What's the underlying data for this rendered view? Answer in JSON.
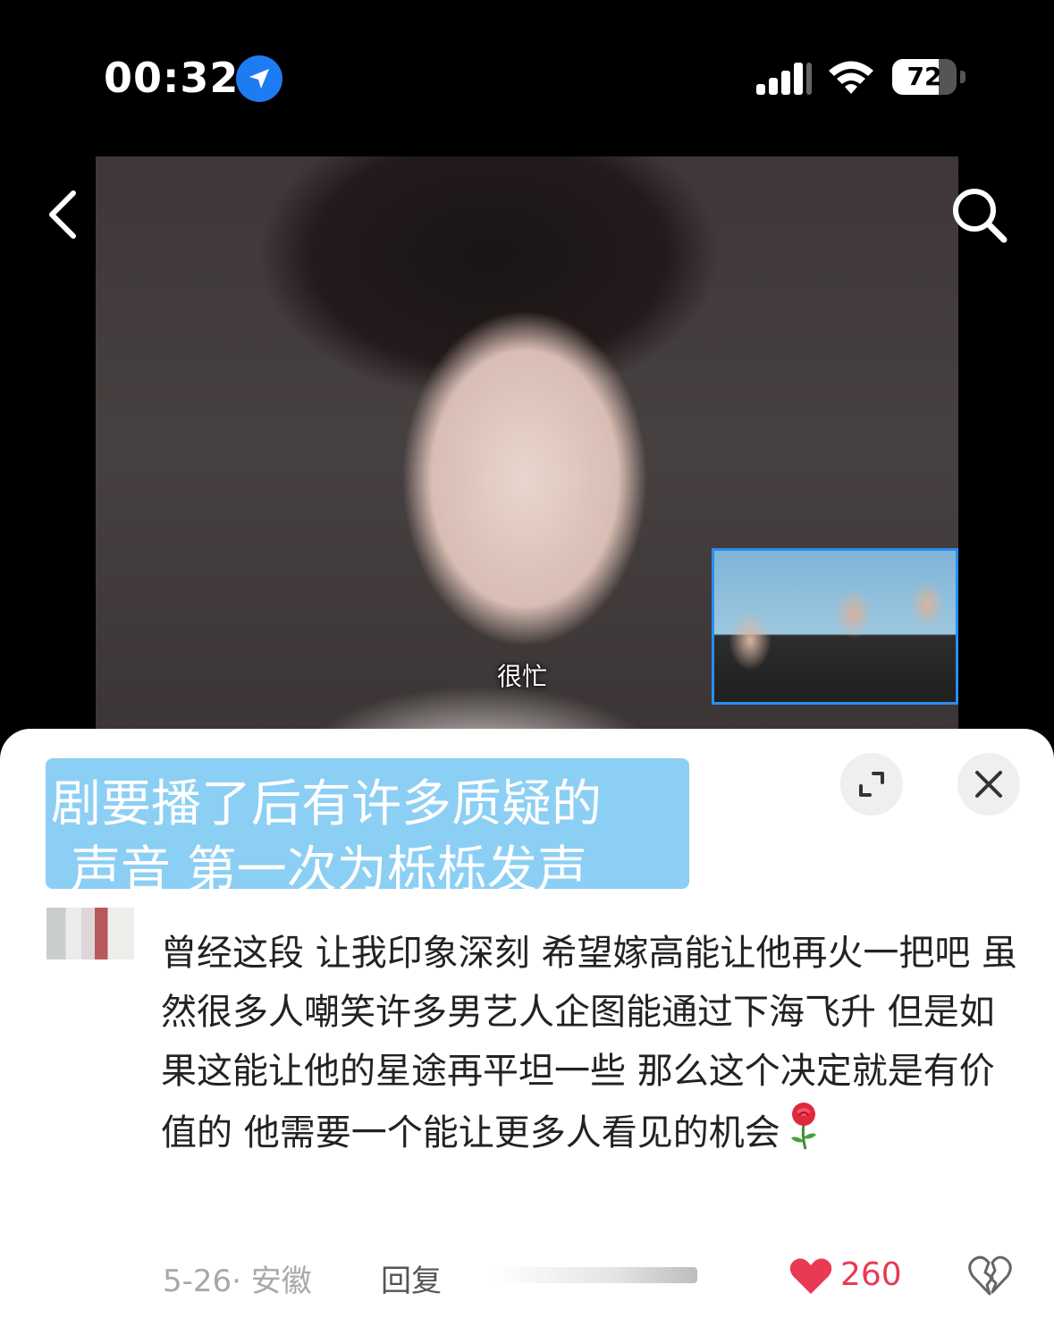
{
  "status_bar": {
    "time": "00:32",
    "battery": "72",
    "battery_level": 0.72
  },
  "icons": {
    "location": "location-arrow-icon",
    "signal": "cellular-signal-icon",
    "wifi": "wifi-icon",
    "battery": "battery-icon",
    "back": "chevron-left-icon",
    "search": "search-icon",
    "expand": "expand-icon",
    "close": "close-icon",
    "rose": "rose-emoji-icon",
    "like": "heart-icon",
    "dislike": "broken-heart-icon"
  },
  "video": {
    "subtitle": "很忙"
  },
  "panel": {
    "title_line_1": "剧要播了后有许多质疑的",
    "title_line_2": "声音 第一次为栎栎发声"
  },
  "comment": {
    "text": "曾经这段 让我印象深刻 希望嫁高能让他再火一把吧 虽然很多人嘲笑许多男艺人企图能通过下海飞升 但是如果这能让他的星途再平坦一些 那么这个决定就是有价值的 他需要一个能让更多人看见的机会",
    "date_location": "5-26· 安徽",
    "reply_label": "回复",
    "likes": "260"
  },
  "colors": {
    "highlight": "#8ccff4",
    "like": "#e83a54",
    "location_blue": "#1e7cf2",
    "pip_border": "#2a8df0"
  }
}
